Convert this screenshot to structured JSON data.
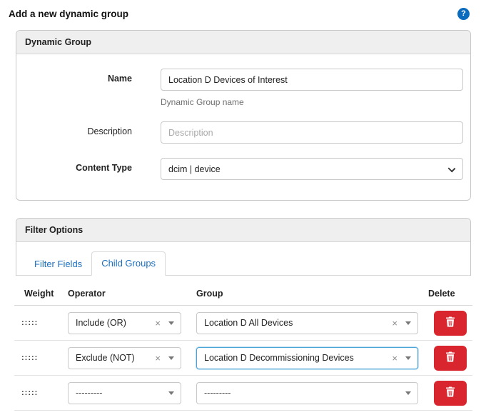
{
  "page": {
    "title": "Add a new dynamic group"
  },
  "icons": {
    "help": "?",
    "drag_handle": ":::::",
    "clear": "×"
  },
  "colors": {
    "accent_blue": "#1a6fc0",
    "delete_red": "#d9262e",
    "panel_header_bg": "#efefef",
    "focus_border": "#4aa4d6"
  },
  "dynamic_group": {
    "title": "Dynamic Group",
    "name": {
      "label": "Name",
      "value": "Location D Devices of Interest",
      "help_text": "Dynamic Group name"
    },
    "description": {
      "label": "Description",
      "value": "",
      "placeholder": "Description"
    },
    "content_type": {
      "label": "Content Type",
      "value": "dcim | device"
    }
  },
  "filter_options": {
    "title": "Filter Options",
    "tabs": [
      {
        "label": "Filter Fields",
        "active": false
      },
      {
        "label": "Child Groups",
        "active": true
      }
    ]
  },
  "child_groups": {
    "columns": [
      "Weight",
      "Operator",
      "Group",
      "Delete"
    ],
    "rows": [
      {
        "operator": "Include (OR)",
        "group": "Location D All Devices",
        "clearable": true,
        "focused": false
      },
      {
        "operator": "Exclude (NOT)",
        "group": "Location D Decommissioning Devices",
        "clearable": true,
        "focused": true
      },
      {
        "operator": "---------",
        "group": "---------",
        "clearable": false,
        "focused": false
      }
    ]
  }
}
